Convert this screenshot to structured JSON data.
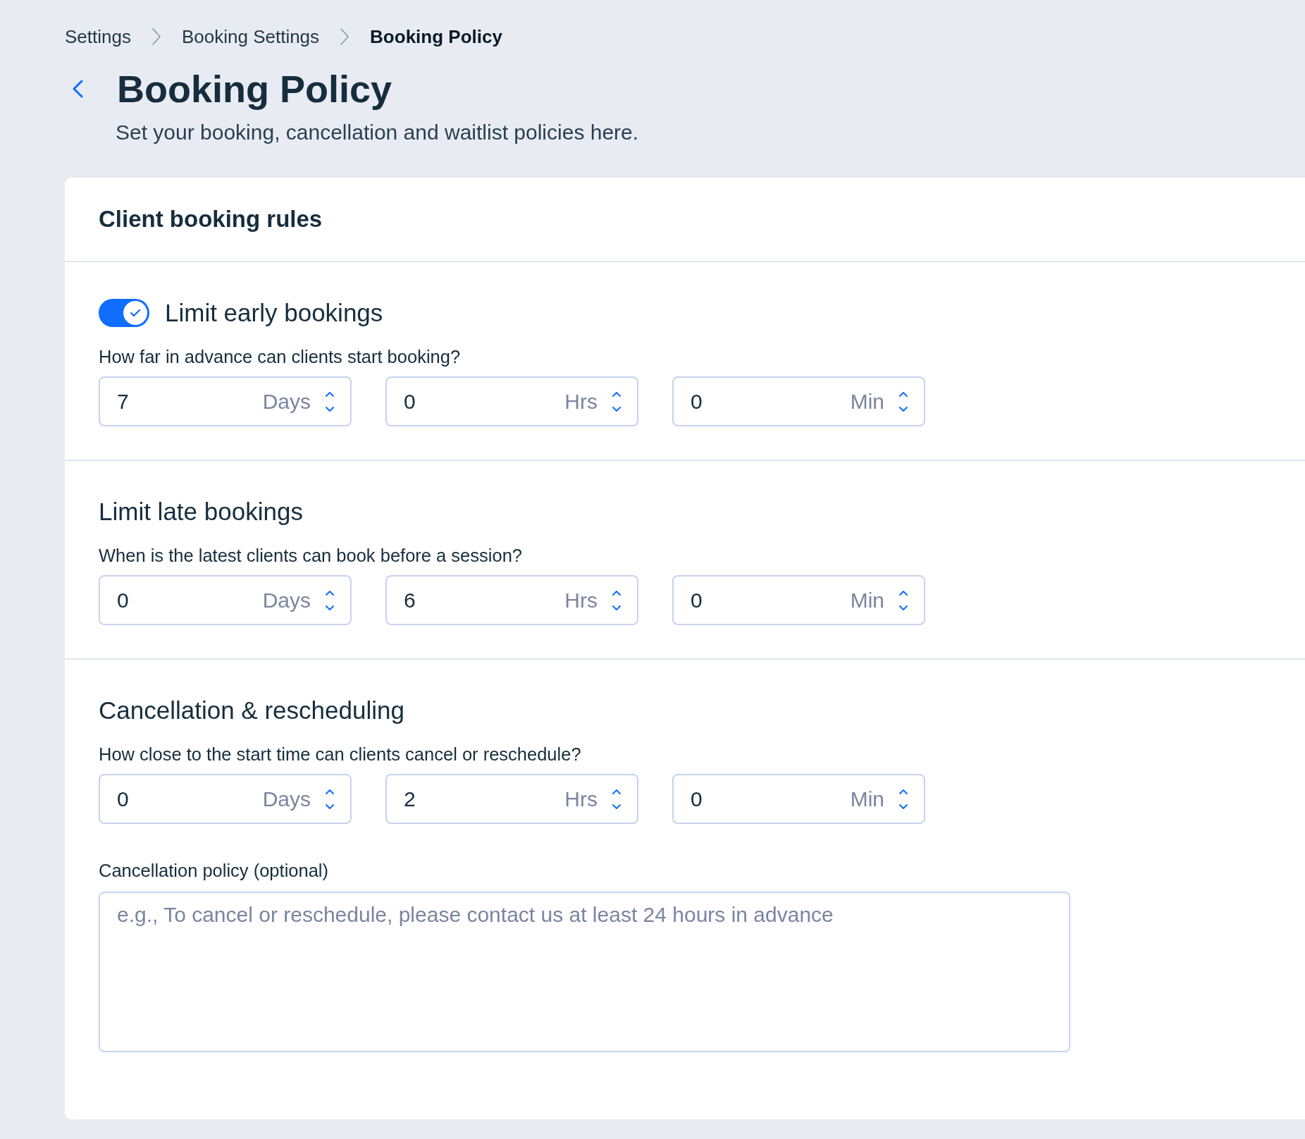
{
  "breadcrumbs": [
    {
      "label": "Settings",
      "current": false
    },
    {
      "label": "Booking Settings",
      "current": false
    },
    {
      "label": "Booking Policy",
      "current": true
    }
  ],
  "title": "Booking Policy",
  "subtitle": "Set your booking, cancellation and waitlist policies here.",
  "card": {
    "title": "Client booking rules",
    "sections": [
      {
        "kind": "toggle",
        "label": "Limit early bookings",
        "on": true,
        "question": "How far in advance can clients start booking?",
        "fields": [
          {
            "value": "7",
            "unit": "Days"
          },
          {
            "value": "0",
            "unit": "Hrs"
          },
          {
            "value": "0",
            "unit": "Min"
          }
        ]
      },
      {
        "kind": "plain",
        "label": "Limit late bookings",
        "question": "When is the latest clients can book before a session?",
        "fields": [
          {
            "value": "0",
            "unit": "Days"
          },
          {
            "value": "6",
            "unit": "Hrs"
          },
          {
            "value": "0",
            "unit": "Min"
          }
        ]
      },
      {
        "kind": "plain",
        "label": "Cancellation & rescheduling",
        "question": "How close to the start time can clients cancel or reschedule?",
        "fields": [
          {
            "value": "0",
            "unit": "Days"
          },
          {
            "value": "2",
            "unit": "Hrs"
          },
          {
            "value": "0",
            "unit": "Min"
          }
        ],
        "textarea": {
          "label": "Cancellation policy (optional)",
          "placeholder": "e.g., To cancel or reschedule, please contact us at least 24 hours in advance"
        }
      }
    ]
  }
}
